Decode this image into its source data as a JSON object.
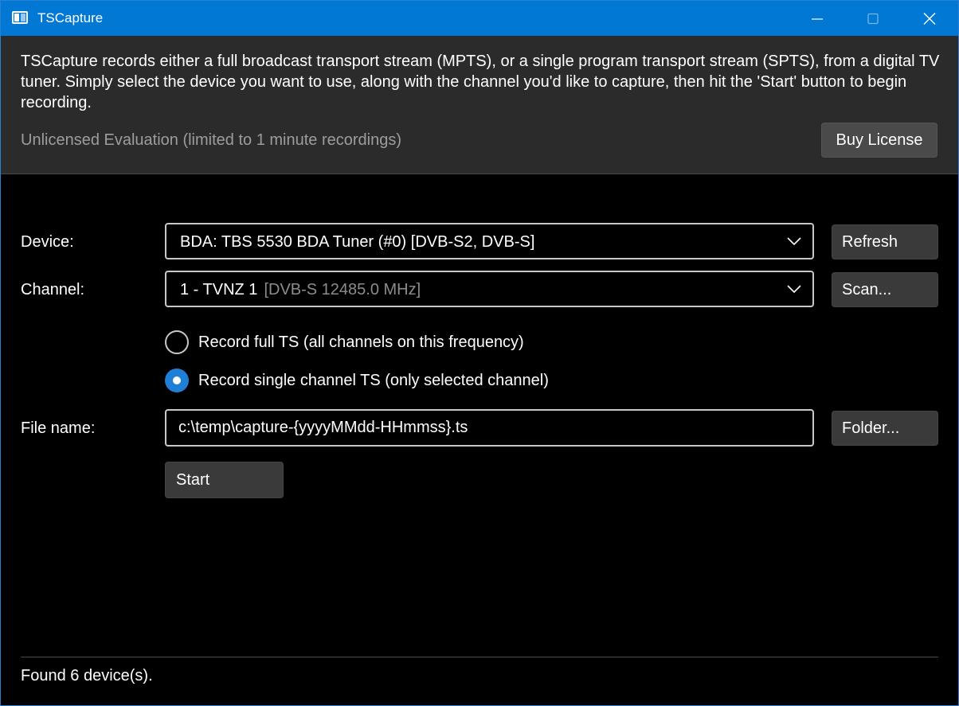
{
  "window": {
    "title": "TSCapture"
  },
  "header": {
    "description": "TSCapture records either a full broadcast transport stream (MPTS), or a single program transport stream (SPTS), from a digital TV tuner. Simply select the device you want to use, along with the channel you'd like to capture, then hit the 'Start' button to begin recording.",
    "license_status": "Unlicensed Evaluation (limited to 1 minute recordings)",
    "buy_label": "Buy License"
  },
  "device": {
    "label": "Device:",
    "selected": "BDA: TBS 5530 BDA Tuner (#0) [DVB-S2, DVB-S]",
    "refresh_label": "Refresh"
  },
  "channel": {
    "label": "Channel:",
    "selected": "1 - TVNZ 1",
    "selected_detail": "[DVB-S 12485.0 MHz]",
    "scan_label": "Scan..."
  },
  "record_mode": {
    "options": [
      {
        "label": "Record full TS (all channels on this frequency)",
        "checked": false
      },
      {
        "label": "Record single channel TS (only selected channel)",
        "checked": true
      }
    ]
  },
  "file": {
    "label": "File name:",
    "value": "c:\\temp\\capture-{yyyyMMdd-HHmmss}.ts",
    "folder_label": "Folder..."
  },
  "actions": {
    "start_label": "Start"
  },
  "status": {
    "text": "Found 6 device(s)."
  },
  "icons": {
    "app": "tscapture-app-icon",
    "minimize": "minimize-icon",
    "maximize": "maximize-icon",
    "close": "close-icon",
    "dropdown": "chevron-down-icon"
  },
  "colors": {
    "titlebar": "#0078d4",
    "accent": "#1f7fd6",
    "header_bg": "#2b2b2b",
    "body_bg": "#000000",
    "muted_text": "#9d9d9d",
    "button_bg": "#3a3a3a"
  }
}
